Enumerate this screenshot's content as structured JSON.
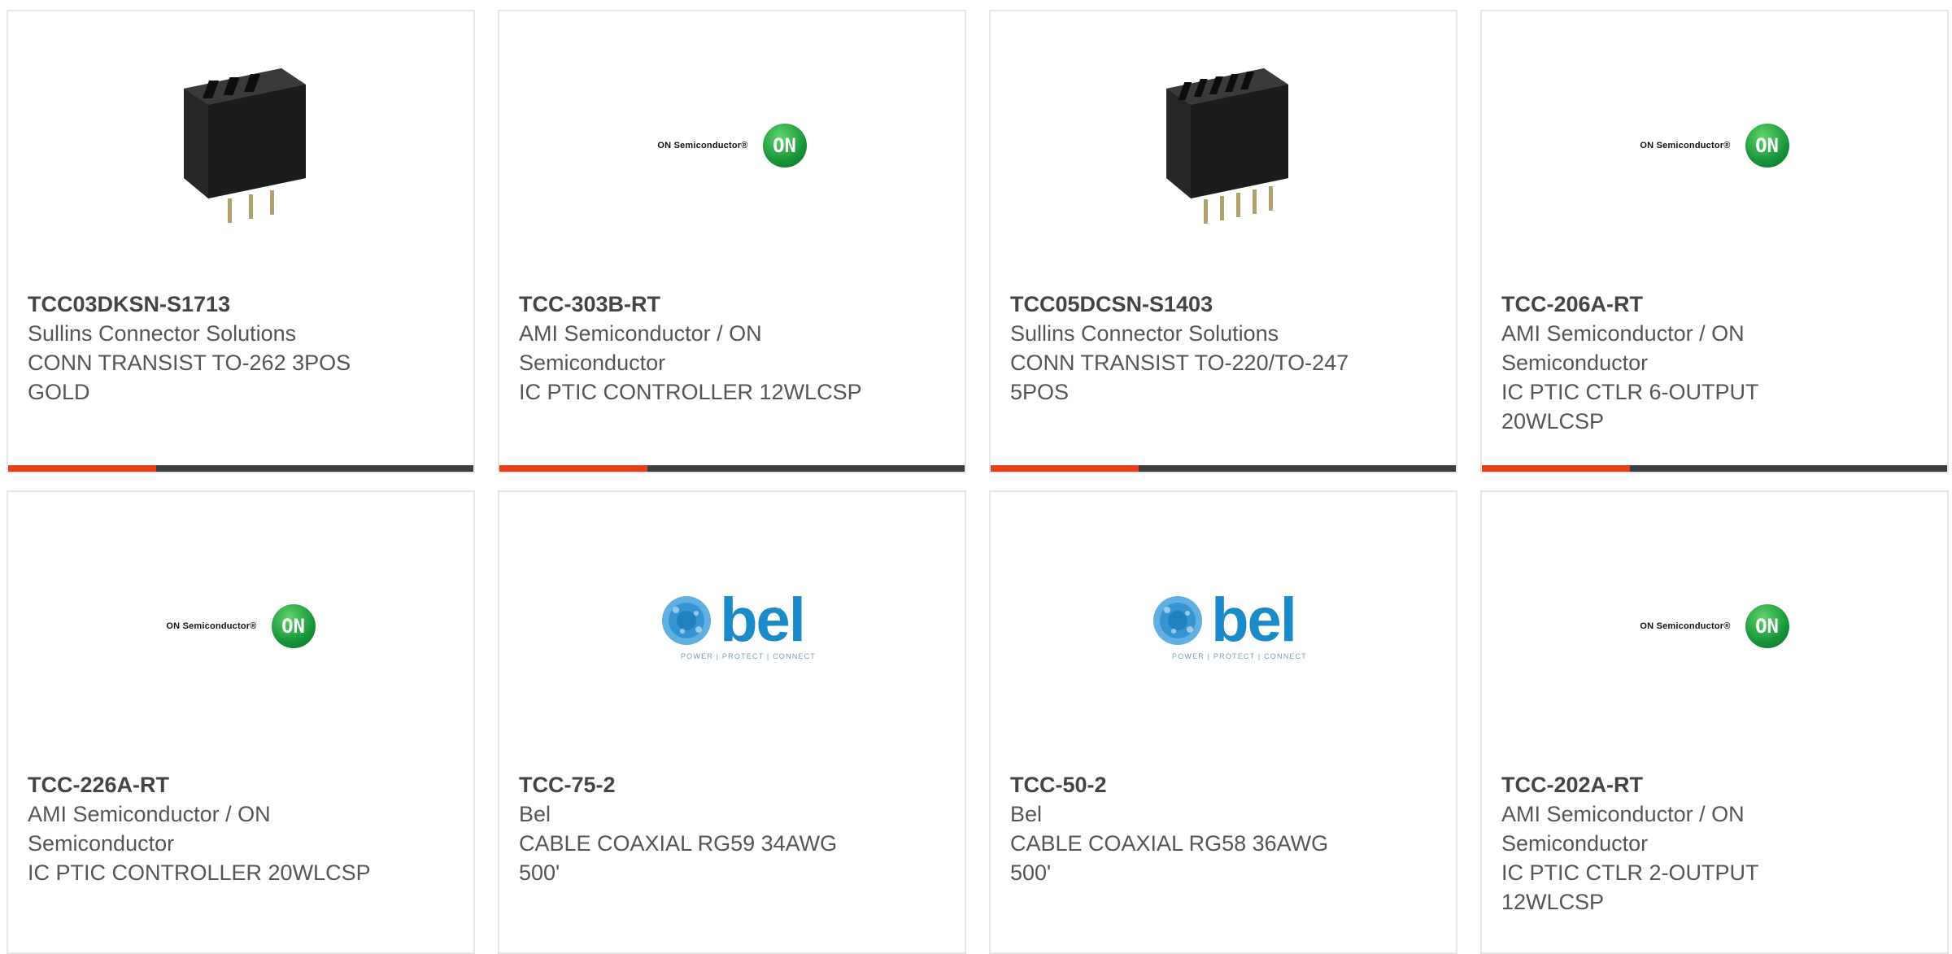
{
  "accent_color": "#e8401c",
  "bar_color": "#3d3d3d",
  "products": [
    {
      "part_number": "TCC03DKSN-S1713",
      "manufacturer": "Sullins Connector Solutions",
      "description": "CONN TRANSIST TO-262 3POS GOLD",
      "image": "connector-3pos"
    },
    {
      "part_number": "TCC-303B-RT",
      "manufacturer": "AMI Semiconductor / ON Semiconductor",
      "description": "IC PTIC CONTROLLER 12WLCSP",
      "image": "on-semiconductor-logo"
    },
    {
      "part_number": "TCC05DCSN-S1403",
      "manufacturer": "Sullins Connector Solutions",
      "description": "CONN TRANSIST TO-220/TO-247 5POS",
      "image": "connector-5pos"
    },
    {
      "part_number": "TCC-206A-RT",
      "manufacturer": "AMI Semiconductor / ON Semiconductor",
      "description": "IC PTIC CTLR 6-OUTPUT 20WLCSP",
      "image": "on-semiconductor-logo"
    },
    {
      "part_number": "TCC-226A-RT",
      "manufacturer": "AMI Semiconductor / ON Semiconductor",
      "description": "IC PTIC CONTROLLER 20WLCSP",
      "image": "on-semiconductor-logo"
    },
    {
      "part_number": "TCC-75-2",
      "manufacturer": "Bel",
      "description": "CABLE COAXIAL RG59 34AWG 500'",
      "image": "bel-logo"
    },
    {
      "part_number": "TCC-50-2",
      "manufacturer": "Bel",
      "description": "CABLE COAXIAL RG58 36AWG 500'",
      "image": "bel-logo"
    },
    {
      "part_number": "TCC-202A-RT",
      "manufacturer": "AMI Semiconductor / ON Semiconductor",
      "description": "IC PTIC CTLR 2-OUTPUT 12WLCSP",
      "image": "on-semiconductor-logo"
    }
  ],
  "logos": {
    "on_text": "ON Semiconductor®",
    "on_mark": "ON",
    "bel_text": "bel",
    "bel_tagline": "POWER | PROTECT | CONNECT"
  }
}
